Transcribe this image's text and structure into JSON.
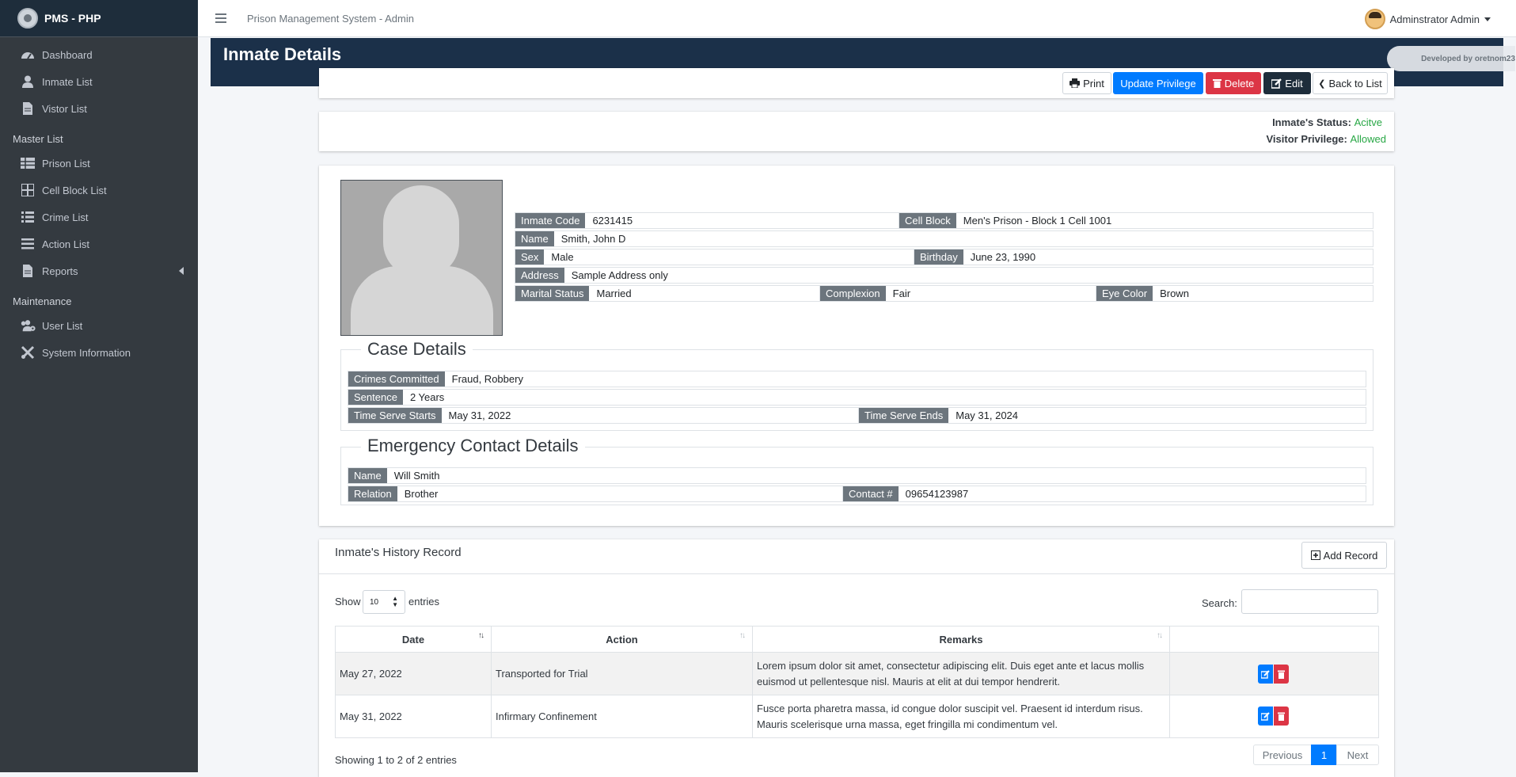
{
  "brand": {
    "name": "PMS - PHP"
  },
  "sidebar": {
    "items": [
      {
        "label": "Dashboard",
        "icon": "dashboard-icon"
      },
      {
        "label": "Inmate List",
        "icon": "user-icon"
      },
      {
        "label": "Vistor List",
        "icon": "file-icon"
      }
    ],
    "master_header": "Master List",
    "master_items": [
      {
        "label": "Prison List",
        "icon": "table-icon"
      },
      {
        "label": "Cell Block List",
        "icon": "grid-icon"
      },
      {
        "label": "Crime List",
        "icon": "list-icon"
      },
      {
        "label": "Action List",
        "icon": "bars-icon"
      },
      {
        "label": "Reports",
        "icon": "file-icon"
      }
    ],
    "maintenance_header": "Maintenance",
    "maintenance_items": [
      {
        "label": "User List",
        "icon": "users-cog-icon"
      },
      {
        "label": "System Information",
        "icon": "tools-icon"
      }
    ]
  },
  "topbar": {
    "title": "Prison Management System - Admin",
    "user": "Adminstrator Admin"
  },
  "page": {
    "title": "Inmate Details",
    "developer": "Developed by oretnom23"
  },
  "actions": {
    "print": "Print",
    "update_privilege": "Update Privilege",
    "delete": "Delete",
    "edit": "Edit",
    "back": "Back to List"
  },
  "status": {
    "inmate_label": "Inmate's Status:",
    "inmate_value": "Acitve",
    "privilege_label": "Visitor Privilege:",
    "privilege_value": "Allowed"
  },
  "inmate": {
    "code_label": "Inmate Code",
    "code": "6231415",
    "cell_label": "Cell Block",
    "cell": "Men's Prison - Block 1 Cell 1001",
    "name_label": "Name",
    "name": "Smith, John D",
    "sex_label": "Sex",
    "sex": "Male",
    "birthday_label": "Birthday",
    "birthday": "June 23, 1990",
    "address_label": "Address",
    "address": "Sample Address only",
    "marital_label": "Marital Status",
    "marital": "Married",
    "complexion_label": "Complexion",
    "complexion": "Fair",
    "eye_label": "Eye Color",
    "eye": "Brown"
  },
  "case": {
    "legend": "Case Details",
    "crimes_label": "Crimes Committed",
    "crimes": "Fraud, Robbery",
    "sentence_label": "Sentence",
    "sentence": "2 Years",
    "start_label": "Time Serve Starts",
    "start": "May 31, 2022",
    "end_label": "Time Serve Ends",
    "end": "May 31, 2024"
  },
  "emergency": {
    "legend": "Emergency Contact Details",
    "name_label": "Name",
    "name": "Will Smith",
    "relation_label": "Relation",
    "relation": "Brother",
    "contact_label": "Contact #",
    "contact": "09654123987"
  },
  "history": {
    "title": "Inmate's History Record",
    "add": "Add Record",
    "show": "Show",
    "entries_value": "10",
    "entries": "entries",
    "search": "Search:",
    "columns": [
      "Date",
      "Action",
      "Remarks"
    ],
    "rows": [
      {
        "date": "May 27, 2022",
        "action": "Transported for Trial",
        "remarks": "Lorem ipsum dolor sit amet, consectetur adipiscing elit. Duis eget ante et lacus mollis euismod ut pellentesque nisl. Mauris at elit at dui tempor hendrerit."
      },
      {
        "date": "May 31, 2022",
        "action": "Infirmary Confinement",
        "remarks": "Fusce porta pharetra massa, id congue dolor suscipit vel. Praesent id interdum risus. Mauris scelerisque urna massa, eget fringilla mi condimentum vel."
      }
    ],
    "info": "Showing 1 to 2 of 2 entries",
    "prev": "Previous",
    "page": "1",
    "next": "Next"
  },
  "colors": {
    "sidebar": "#343a40",
    "header": "#1b3049",
    "primary": "#007bff",
    "danger": "#dc3545",
    "success": "#28a745"
  }
}
